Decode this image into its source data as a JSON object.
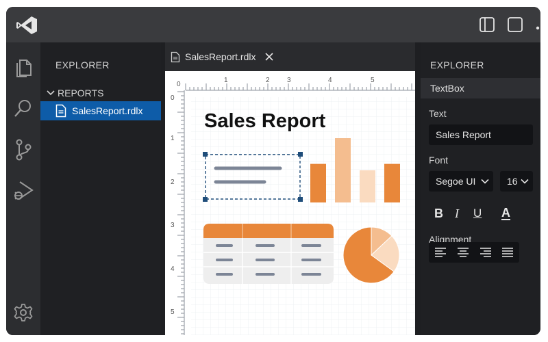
{
  "sidebar": {
    "header": "EXPLORER",
    "folder": "REPORTS",
    "file": "SalesReport.rdlx"
  },
  "editor": {
    "tab_label": "SalesReport.rdlx",
    "ruler_top": [
      "0",
      "1",
      "2",
      "3",
      "4",
      "5"
    ],
    "ruler_left": [
      "0",
      "1",
      "2",
      "3",
      "4",
      "5"
    ],
    "report_title": "Sales Report"
  },
  "properties": {
    "header": "EXPLORER",
    "section": "TextBox",
    "text_label": "Text",
    "text_value": "Sales Report",
    "font_label": "Font",
    "font_family": "Segoe UI",
    "font_size": "16",
    "alignment_label": "Alignment",
    "bold_label": "B",
    "italic_label": "I",
    "underline_label": "U",
    "color_label": "A"
  },
  "chart_data": {
    "type": "bar",
    "values": [
      30,
      50,
      25,
      30
    ],
    "colors": [
      "#e8873a",
      "#f4bd8f",
      "#fadbc0",
      "#e8873a"
    ]
  },
  "pie_data": {
    "type": "pie",
    "values": [
      13,
      22,
      65
    ],
    "colors": [
      "#f4bd8f",
      "#fadbc0",
      "#e8873a"
    ]
  },
  "colors": {
    "accent": "#0e5ca8",
    "orange": "#e8873a"
  }
}
